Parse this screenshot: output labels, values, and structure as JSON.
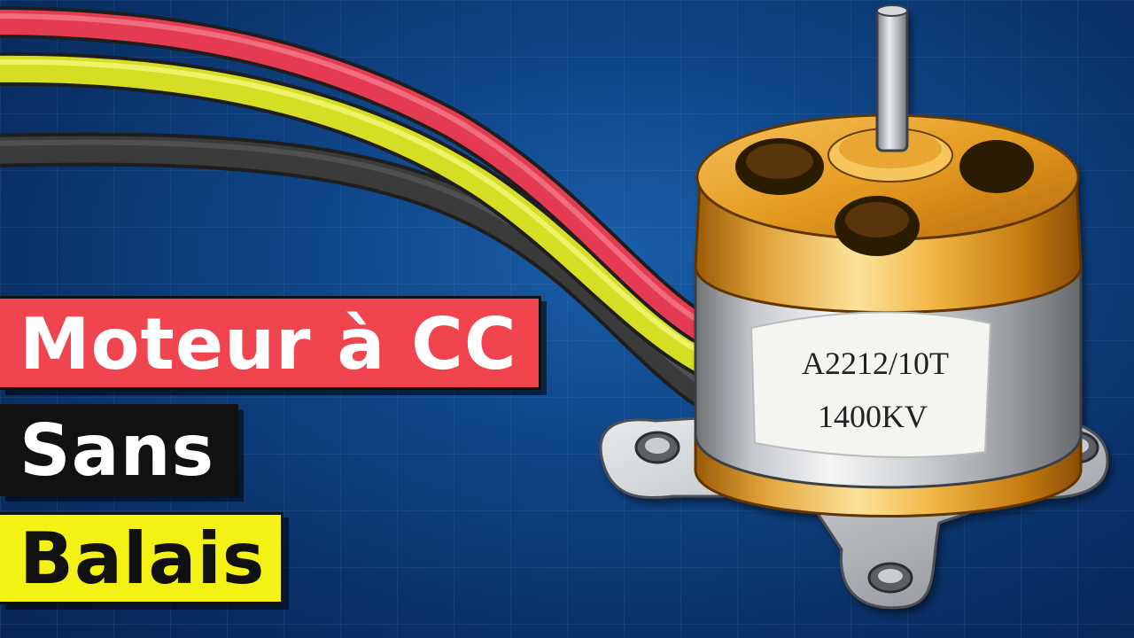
{
  "caption": {
    "line1": {
      "text": "Moteur à CC",
      "bg": "#f0454e",
      "fg": "#ffffff"
    },
    "line2": {
      "text": "Sans",
      "bg": "#111111",
      "fg": "#ffffff"
    },
    "line3": {
      "text": "Balais",
      "bg": "#f4f214",
      "fg": "#111111"
    }
  },
  "motor": {
    "label_line1": "A2212/10T",
    "label_line2": "1400KV"
  },
  "colors": {
    "background": "#0f4689",
    "wire_red": "#e0394f",
    "wire_yellow": "#d9e227",
    "wire_black": "#3a3a3a",
    "bell_gold": "#e8a524",
    "stator_silver": "#c9ccd0"
  }
}
